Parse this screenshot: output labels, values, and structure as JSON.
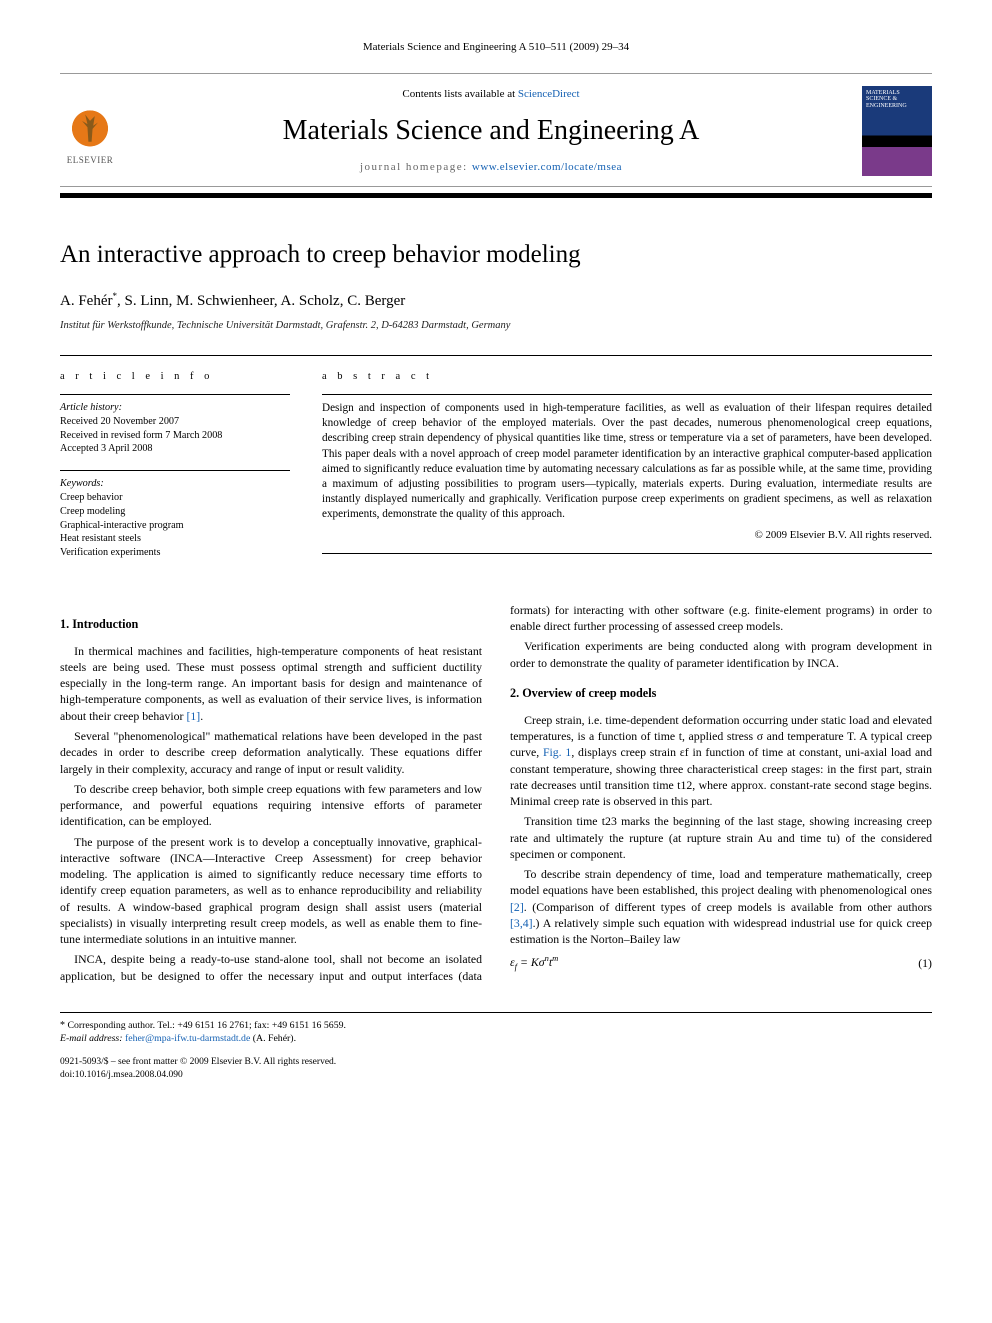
{
  "running_head": "Materials Science and Engineering A 510–511 (2009) 29–34",
  "masthead": {
    "contents_prefix": "Contents lists available at ",
    "contents_link": "ScienceDirect",
    "journal_name": "Materials Science and Engineering A",
    "homepage_prefix": "journal homepage: ",
    "homepage_url": "www.elsevier.com/locate/msea",
    "publisher_name": "ELSEVIER",
    "cover_label_1": "MATERIALS",
    "cover_label_2": "SCIENCE &",
    "cover_label_3": "ENGINEERING"
  },
  "article": {
    "title": "An interactive approach to creep behavior modeling",
    "authors_html": "A. Fehér*, S. Linn, M. Schwienheer, A. Scholz, C. Berger",
    "affiliation": "Institut für Werkstoffkunde, Technische Universität Darmstadt, Grafenstr. 2, D-64283 Darmstadt, Germany"
  },
  "info": {
    "section_label": "a r t i c l e   i n f o",
    "history_label": "Article history:",
    "history": {
      "received": "Received 20 November 2007",
      "revised": "Received in revised form 7 March 2008",
      "accepted": "Accepted 3 April 2008"
    },
    "keywords_label": "Keywords:",
    "keywords": [
      "Creep behavior",
      "Creep modeling",
      "Graphical-interactive program",
      "Heat resistant steels",
      "Verification experiments"
    ]
  },
  "abstract": {
    "section_label": "a b s t r a c t",
    "text": "Design and inspection of components used in high-temperature facilities, as well as evaluation of their lifespan requires detailed knowledge of creep behavior of the employed materials. Over the past decades, numerous phenomenological creep equations, describing creep strain dependency of physical quantities like time, stress or temperature via a set of parameters, have been developed. This paper deals with a novel approach of creep model parameter identification by an interactive graphical computer-based application aimed to significantly reduce evaluation time by automating necessary calculations as far as possible while, at the same time, providing a maximum of adjusting possibilities to program users—typically, materials experts. During evaluation, intermediate results are instantly displayed numerically and graphically. Verification purpose creep experiments on gradient specimens, as well as relaxation experiments, demonstrate the quality of this approach.",
    "copyright": "© 2009 Elsevier B.V. All rights reserved."
  },
  "body": {
    "sec1_title": "1.  Introduction",
    "sec1_p1": "In thermical machines and facilities, high-temperature components of heat resistant steels are being used. These must possess optimal strength and sufficient ductility especially in the long-term range. An important basis for design and maintenance of high-temperature components, as well as evaluation of their service lives, is information about their creep behavior ",
    "sec1_p1_ref": "[1]",
    "sec1_p1_tail": ".",
    "sec1_p2": "Several \"phenomenological\" mathematical relations have been developed in the past decades in order to describe creep deformation analytically. These equations differ largely in their complexity, accuracy and range of input or result validity.",
    "sec1_p3": "To describe creep behavior, both simple creep equations with few parameters and low performance, and powerful equations requiring intensive efforts of parameter identification, can be employed.",
    "sec1_p4": "The purpose of the present work is to develop a conceptually innovative, graphical-interactive software (INCA—Interactive Creep Assessment) for creep behavior modeling. The application is aimed to significantly reduce necessary time efforts to identify creep equation parameters, as well as to enhance reproducibility and reliability of results. A window-based graphical program design shall assist users (material specialists) in visually interpreting result creep models, as well as enable them to fine-tune intermediate solutions in an intuitive manner.",
    "sec1_p5": "INCA, despite being a ready-to-use stand-alone tool, shall not become an isolated application, but be designed to offer the necessary input and output interfaces (data formats) for interacting with other software (e.g. finite-element programs) in order to enable direct further processing of assessed creep models.",
    "sec1_p6": "Verification experiments are being conducted along with program development in order to demonstrate the quality of parameter identification by INCA.",
    "sec2_title": "2.  Overview of creep models",
    "sec2_p1a": "Creep strain, i.e. time-dependent deformation occurring under static load and elevated temperatures, is a function of time t, applied stress σ and temperature T. A typical creep curve, ",
    "sec2_p1_fig": "Fig. 1",
    "sec2_p1b": ", displays creep strain εf in function of time at constant, uni-axial load and constant temperature, showing three characteristical creep stages: in the first part, strain rate decreases until transition time t12, where approx. constant-rate second stage begins. Minimal creep rate is observed in this part.",
    "sec2_p2": "Transition time t23 marks the beginning of the last stage, showing increasing creep rate and ultimately the rupture (at rupture strain Au and time tu) of the considered specimen or component.",
    "sec2_p3a": "To describe strain dependency of time, load and temperature mathematically, creep model equations have been established, this project dealing with phenomenological ones ",
    "sec2_p3_ref1": "[2]",
    "sec2_p3b": ". (Comparison of different types of creep models is available from other authors ",
    "sec2_p3_ref2": "[3,4]",
    "sec2_p3c": ".) A relatively simple such equation with widespread industrial use for quick creep estimation is the Norton–Bailey law",
    "eq1_lhs": "εf = Kσⁿtᵐ",
    "eq1_num": "(1)"
  },
  "footer": {
    "corr_line": "Corresponding author. Tel.: +49 6151 16 2761; fax: +49 6151 16 5659.",
    "email_label": "E-mail address:",
    "email": "feher@mpa-ifw.tu-darmstadt.de",
    "email_tail": " (A. Fehér).",
    "issn_line": "0921-5093/$ – see front matter © 2009 Elsevier B.V. All rights reserved.",
    "doi_line": "doi:10.1016/j.msea.2008.04.090"
  }
}
